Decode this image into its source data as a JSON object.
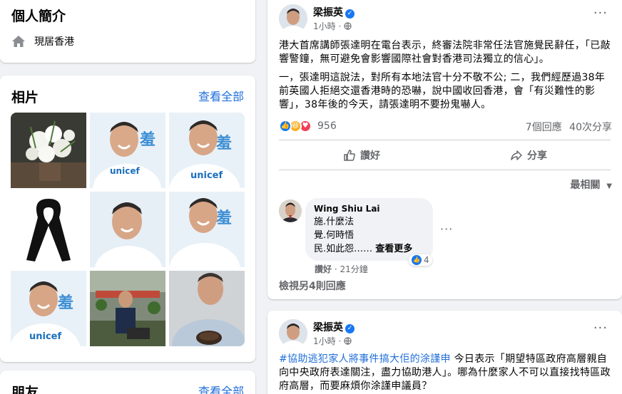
{
  "intro": {
    "title": "個人簡介",
    "location": "現居香港"
  },
  "photos": {
    "title": "相片",
    "see_all": "查看全部"
  },
  "friends": {
    "title": "朋友",
    "see_all": "查看全部"
  },
  "post1": {
    "author": "梁振英",
    "time": "1小時 ·",
    "paragraph1": "港大首席講師張達明在電台表示，終審法院非常任法官施覺民辭任，「已敲響警鐘，無可避免會影響國際社會對香港司法獨立的信心」。",
    "paragraph2": "一，張達明這說法，對所有本地法官十分不敬不公; 二，我們經歷過38年前英國人拒絕交還香港時的恐嚇，說中國收回香港，會「有災難性的影響」，38年後的今天，請張達明不要扮鬼嚇人。",
    "reaction_count": "956",
    "comments": "7個回應",
    "shares": "40次分享",
    "like_label": "讚好",
    "share_label": "分享",
    "sort_label": "最相關",
    "comment": {
      "name": "Wing Shiu Lai",
      "line1": "施.什麼法",
      "line2": "覺.何時悟",
      "line3": "民.如此怨……",
      "see_more": "查看更多",
      "likes": "4",
      "like_action": "讚好",
      "time": "· 21分鐘"
    },
    "more_replies": "檢視另4則回應"
  },
  "post2": {
    "author": "梁振英",
    "time": "1小時 ·",
    "hashtag": "#協助逃犯家人將事件搞大佢的涂謹申",
    "text": " 今日表示「期望特區政府高層親自向中央政府表達關注，盡力協助港人」。哪為什麼家人不可以直接找特區政府高層，而要麻煩你涂謹申議員？"
  },
  "colors": {
    "link": "#216fdb",
    "like": "#1877f2",
    "love": "#f33e58",
    "haha": "#f7b125"
  }
}
